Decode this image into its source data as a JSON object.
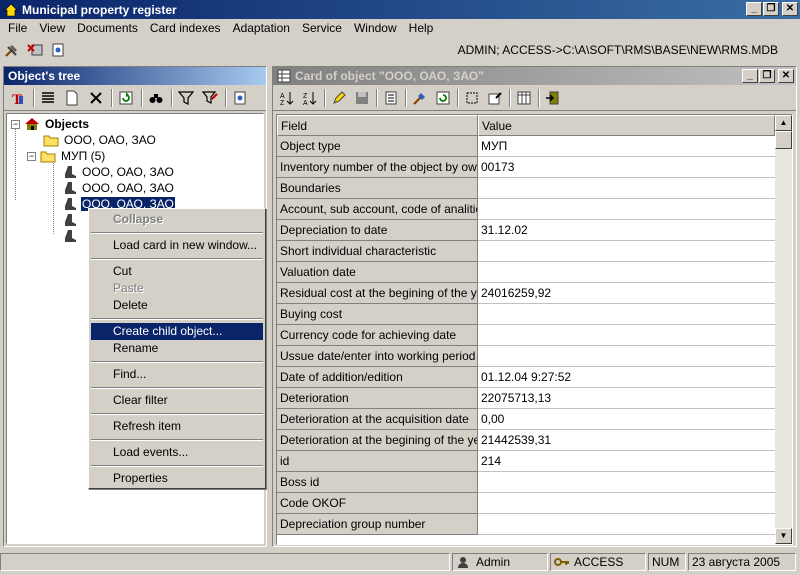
{
  "app": {
    "title": "Municipal property register",
    "path": "ADMIN; ACCESS->C:\\A\\SOFT\\RMS\\BASE\\NEW\\RMS.MDB"
  },
  "window_buttons": {
    "minimize": "_",
    "restore": "❐",
    "close": "✕"
  },
  "menu": [
    "File",
    "View",
    "Documents",
    "Card indexes",
    "Adaptation",
    "Service",
    "Window",
    "Help"
  ],
  "tree_panel": {
    "title": "Object's tree",
    "root": "Objects",
    "nodes": [
      "ООО, ОАО, ЗАО",
      "МУП (5)",
      "ООО, ОАО, ЗАО",
      "ООО, ОАО, ЗАО",
      "ООО, ОАО, ЗАО"
    ]
  },
  "context_menu": {
    "items": [
      "Collapse",
      "Load card in new window...",
      "Cut",
      "Paste",
      "Delete",
      "Create child object...",
      "Rename",
      "Find...",
      "Clear filter",
      "Refresh item",
      "Load events...",
      "Properties"
    ]
  },
  "card": {
    "title": "Card of object \"ООО, ОАО, ЗАО\"",
    "headers": {
      "field": "Field",
      "value": "Value"
    },
    "rows": [
      {
        "field": "Object type",
        "value": "МУП"
      },
      {
        "field": "Inventory number of the object by owner",
        "value": "00173"
      },
      {
        "field": "Boundaries",
        "value": ""
      },
      {
        "field": "Account, sub account, code of analitical",
        "value": ""
      },
      {
        "field": "Depreciation to date",
        "value": "31.12.02"
      },
      {
        "field": "Short individual characteristic",
        "value": ""
      },
      {
        "field": "Valuation date",
        "value": ""
      },
      {
        "field": "Residual cost at the begining of the year",
        "value": "24016259,92"
      },
      {
        "field": "Buying cost",
        "value": ""
      },
      {
        "field": "Currency code for achieving date",
        "value": ""
      },
      {
        "field": "Ussue date/enter into working period",
        "value": ""
      },
      {
        "field": "Date of addition/edition",
        "value": "01.12.04 9:27:52"
      },
      {
        "field": "Deterioration",
        "value": "22075713,13"
      },
      {
        "field": "Deterioration at the acquisition date",
        "value": "0,00"
      },
      {
        "field": "Deterioration at the begining of the year",
        "value": "21442539,31"
      },
      {
        "field": "id",
        "value": "214"
      },
      {
        "field": "Boss id",
        "value": ""
      },
      {
        "field": "Code OKOF",
        "value": ""
      },
      {
        "field": "Depreciation group number",
        "value": ""
      }
    ]
  },
  "status": {
    "user": "Admin",
    "db": "ACCESS",
    "num": "NUM",
    "date": "23 августа 2005"
  }
}
